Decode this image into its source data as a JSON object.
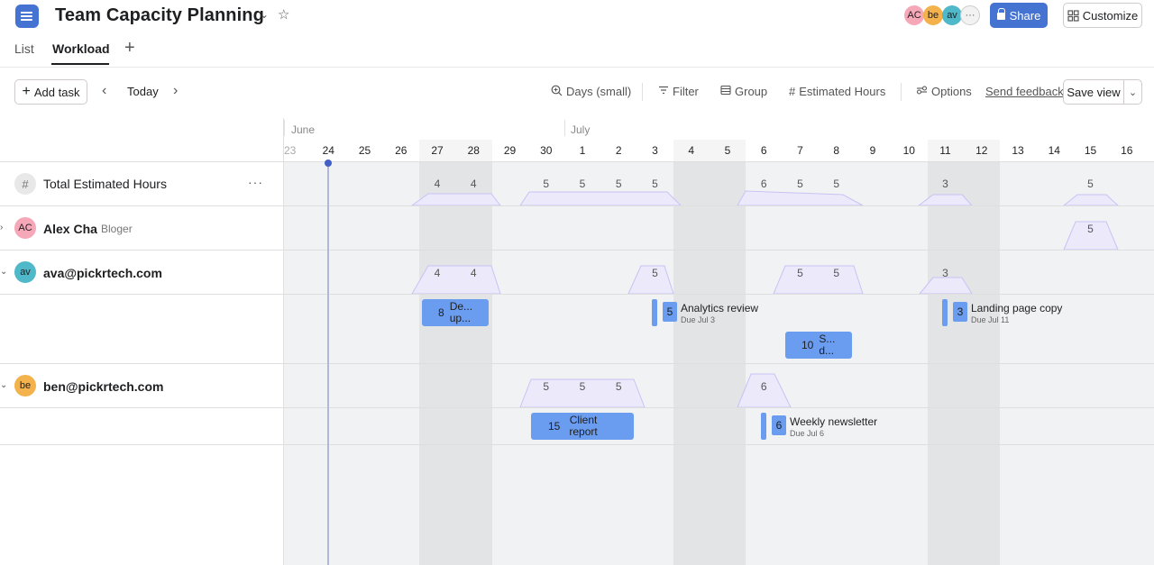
{
  "header": {
    "title": "Team Capacity Planning",
    "tabs": [
      {
        "label": "List"
      },
      {
        "label": "Workload"
      }
    ],
    "avatars": [
      {
        "initials": "AC",
        "color": "#f7a8b8"
      },
      {
        "initials": "be",
        "color": "#f4b24c"
      },
      {
        "initials": "av",
        "color": "#4fb8c9"
      }
    ],
    "share_label": "Share",
    "customize_label": "Customize"
  },
  "toolbar": {
    "add_task": "Add task",
    "today": "Today",
    "days": "Days (small)",
    "filter": "Filter",
    "group": "Group",
    "estimated_hours": "Estimated Hours",
    "options": "Options",
    "send_feedback": "Send feedback",
    "save_view": "Save view"
  },
  "timeline": {
    "months": [
      {
        "label": "June",
        "day": "23"
      },
      {
        "label": "July",
        "day": "1"
      }
    ],
    "days": [
      "23",
      "24",
      "25",
      "26",
      "27",
      "28",
      "29",
      "30",
      "1",
      "2",
      "3",
      "4",
      "5",
      "6",
      "7",
      "8",
      "9",
      "10",
      "11",
      "12",
      "13",
      "14",
      "15",
      "16"
    ],
    "today": "24",
    "weekend_pairs": [
      [
        "27",
        "28"
      ],
      [
        "4",
        "5"
      ],
      [
        "11",
        "12"
      ]
    ]
  },
  "rows": {
    "total": {
      "label": "Total Estimated Hours",
      "values": [
        {
          "day": "27",
          "v": "4"
        },
        {
          "day": "28",
          "v": "4"
        },
        {
          "day": "30",
          "v": "5"
        },
        {
          "day": "1",
          "v": "5"
        },
        {
          "day": "2",
          "v": "5"
        },
        {
          "day": "3",
          "v": "5"
        },
        {
          "day": "6",
          "v": "6"
        },
        {
          "day": "7",
          "v": "5"
        },
        {
          "day": "8",
          "v": "5"
        },
        {
          "day": "11",
          "v": "3"
        },
        {
          "day": "15",
          "v": "5"
        }
      ]
    },
    "alex": {
      "initials": "AC",
      "name": "Alex Cha",
      "role": "Bloger",
      "color": "#f7a8b8",
      "values": [
        {
          "day": "15",
          "v": "5"
        }
      ]
    },
    "ava": {
      "initials": "av",
      "name": "ava@pickrtech.com",
      "color": "#4fb8c9",
      "values": [
        {
          "day": "27",
          "v": "4"
        },
        {
          "day": "28",
          "v": "4"
        },
        {
          "day": "3",
          "v": "5"
        },
        {
          "day": "7",
          "v": "5"
        },
        {
          "day": "8",
          "v": "5"
        },
        {
          "day": "11",
          "v": "3"
        }
      ]
    },
    "ben": {
      "initials": "be",
      "name": "ben@pickrtech.com",
      "color": "#f4b24c",
      "values": [
        {
          "day": "30",
          "v": "5"
        },
        {
          "day": "1",
          "v": "5"
        },
        {
          "day": "2",
          "v": "5"
        },
        {
          "day": "6",
          "v": "6"
        }
      ]
    }
  },
  "tasks": {
    "ava_1": {
      "hours": "8",
      "title_l1": "De...",
      "title_l2": "up..."
    },
    "ava_2": {
      "hours": "5",
      "title": "Analytics review",
      "due": "Due Jul 3"
    },
    "ava_3": {
      "hours": "3",
      "title": "Landing page copy",
      "due": "Due Jul 11"
    },
    "ava_4": {
      "hours": "10",
      "title_l1": "S...",
      "title_l2": "d..."
    },
    "ben_1": {
      "hours": "15",
      "title_l1": "Client",
      "title_l2": "report"
    },
    "ben_2": {
      "hours": "6",
      "title": "Weekly newsletter",
      "due": "Due Jul 6"
    }
  },
  "colors": {
    "accent": "#4573d2",
    "task": "#6a9cf0",
    "capacity": "#ece9fb",
    "capacity_stroke": "#c9c2f5"
  }
}
